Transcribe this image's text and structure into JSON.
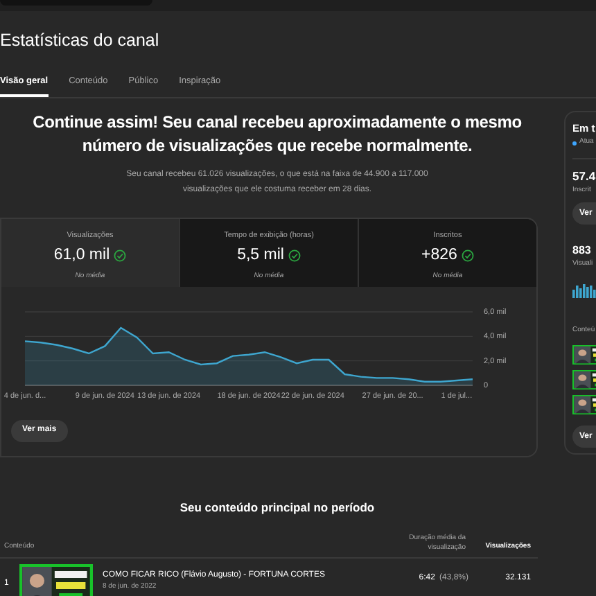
{
  "page_title": "Estatísticas do canal",
  "tabs": [
    {
      "label": "Visão geral",
      "selected": true
    },
    {
      "label": "Conteúdo",
      "selected": false
    },
    {
      "label": "Público",
      "selected": false
    },
    {
      "label": "Inspiração",
      "selected": false
    }
  ],
  "headline": "Continue assim! Seu canal recebeu aproximadamente o mesmo número de visualizações que recebe normalmente.",
  "summary": "Seu canal recebeu 61.026 visualizações, o que está na faixa de 44.900 a 117.000 visualizações que ele costuma receber em 28 dias.",
  "metrics": [
    {
      "label": "Visualizações",
      "value": "61,0 mil",
      "note": "No média",
      "selected": true
    },
    {
      "label": "Tempo de exibição (horas)",
      "value": "5,5 mil",
      "note": "No média",
      "selected": false
    },
    {
      "label": "Inscritos",
      "value": "+826",
      "note": "No média",
      "selected": false
    }
  ],
  "chart": {
    "chart_data": {
      "type": "area",
      "categories": [
        "4 de jun. d...",
        null,
        null,
        null,
        null,
        "9 de jun. de 2024",
        null,
        null,
        null,
        "13 de jun. de 2024",
        null,
        null,
        null,
        null,
        "18 de jun. de 2024",
        null,
        null,
        null,
        "22 de jun. de 2024",
        null,
        null,
        null,
        null,
        "27 de jun. de 20...",
        null,
        null,
        null,
        "1 de jul...",
        null
      ],
      "series": [
        {
          "color": "#3ea6cf",
          "values": [
            3.6,
            3.5,
            3.3,
            3.0,
            2.6,
            3.2,
            4.7,
            3.9,
            2.6,
            2.7,
            2.1,
            1.7,
            1.8,
            2.4,
            2.5,
            2.7,
            2.3,
            1.8,
            2.1,
            2.1,
            0.9,
            0.7,
            0.6,
            0.6,
            0.5,
            0.3,
            0.3,
            0.4,
            0.5
          ]
        }
      ],
      "ylim": [
        0,
        6
      ],
      "yticks": [
        {
          "value": 0,
          "label": "0"
        },
        {
          "value": 2,
          "label": "2,0 mil"
        },
        {
          "value": 4,
          "label": "4,0 mil"
        },
        {
          "value": 6,
          "label": "6,0 mil"
        }
      ]
    }
  },
  "see_more": "Ver mais",
  "top_content": {
    "title": "Seu conteúdo principal no período",
    "columns": [
      "Conteúdo",
      "Duração média da visualização",
      "Visualizações"
    ],
    "rows": [
      {
        "rank": "1",
        "title": "COMO FICAR RICO (Flávio Augusto) - FORTUNA CORTES",
        "date": "8 de jun. de 2022",
        "duration": "6:42",
        "percent": "(43,8%)",
        "views": "32.131"
      }
    ]
  },
  "side_panel": {
    "title": "Em t",
    "status": "Atua",
    "subscribers": "57.4",
    "subscribers_label": "Inscrit",
    "button": "Ver",
    "views": "883",
    "views_label": "Visuali",
    "content_label": "Conteú",
    "button2": "Ver"
  }
}
